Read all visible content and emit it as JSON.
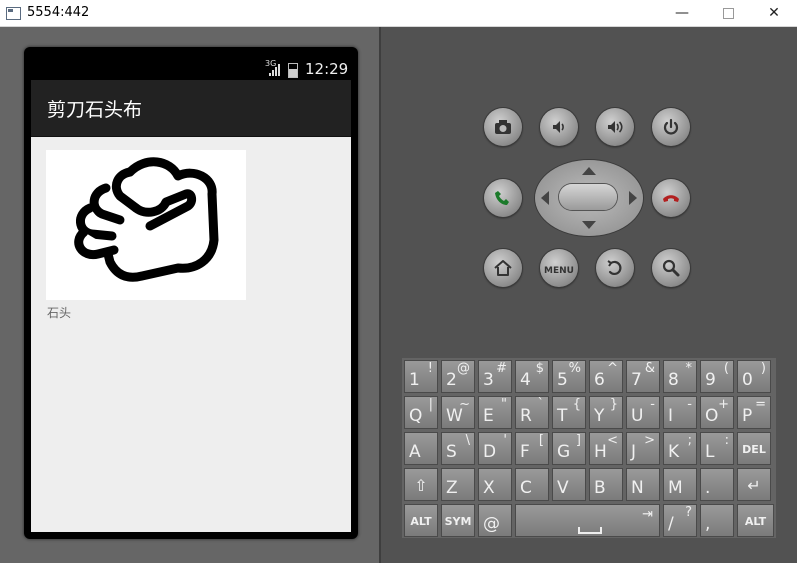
{
  "window": {
    "title": "5554:442",
    "minimize": "—",
    "close": "✕"
  },
  "status": {
    "network": "3G",
    "time": "12:29"
  },
  "app": {
    "title": "剪刀石头布",
    "image_caption": "石头",
    "image_icon": "fist-icon"
  },
  "controls": {
    "camera": "camera-icon",
    "volume_down": "volume-down-icon",
    "volume_up": "volume-up-icon",
    "power": "power-icon",
    "call": "call-icon",
    "end_call": "end-call-icon",
    "home": "home-icon",
    "menu": "MENU",
    "back": "back-icon",
    "search": "search-icon"
  },
  "keyboard": {
    "rows": [
      [
        {
          "m": "1",
          "s": "!"
        },
        {
          "m": "2",
          "s": "@"
        },
        {
          "m": "3",
          "s": "#"
        },
        {
          "m": "4",
          "s": "$"
        },
        {
          "m": "5",
          "s": "%"
        },
        {
          "m": "6",
          "s": "^"
        },
        {
          "m": "7",
          "s": "&"
        },
        {
          "m": "8",
          "s": "*"
        },
        {
          "m": "9",
          "s": "("
        },
        {
          "m": "0",
          "s": ")"
        }
      ],
      [
        {
          "m": "Q",
          "s": "|"
        },
        {
          "m": "W",
          "s": "~"
        },
        {
          "m": "E",
          "s": "\""
        },
        {
          "m": "R",
          "s": "`"
        },
        {
          "m": "T",
          "s": "{"
        },
        {
          "m": "Y",
          "s": "}"
        },
        {
          "m": "U",
          "s": "-"
        },
        {
          "m": "I",
          "s": "-"
        },
        {
          "m": "O",
          "s": "+"
        },
        {
          "m": "P",
          "s": "="
        }
      ],
      [
        {
          "m": "A",
          "s": ""
        },
        {
          "m": "S",
          "s": "\\"
        },
        {
          "m": "D",
          "s": "'"
        },
        {
          "m": "F",
          "s": "["
        },
        {
          "m": "G",
          "s": "]"
        },
        {
          "m": "H",
          "s": "<"
        },
        {
          "m": "J",
          "s": ">"
        },
        {
          "m": "K",
          "s": ";"
        },
        {
          "m": "L",
          "s": ":"
        },
        {
          "m": "DEL",
          "s": ""
        }
      ],
      [
        {
          "m": "⇧",
          "s": ""
        },
        {
          "m": "Z",
          "s": ""
        },
        {
          "m": "X",
          "s": ""
        },
        {
          "m": "C",
          "s": ""
        },
        {
          "m": "V",
          "s": ""
        },
        {
          "m": "B",
          "s": ""
        },
        {
          "m": "N",
          "s": ""
        },
        {
          "m": "M",
          "s": ""
        },
        {
          "m": ".",
          "s": ""
        },
        {
          "m": "↵",
          "s": ""
        }
      ]
    ],
    "bottom": {
      "alt_left": "ALT",
      "sym": "SYM",
      "at": "@",
      "slash": "/",
      "question": "?",
      "comma": ",",
      "alt_right": "ALT"
    }
  }
}
